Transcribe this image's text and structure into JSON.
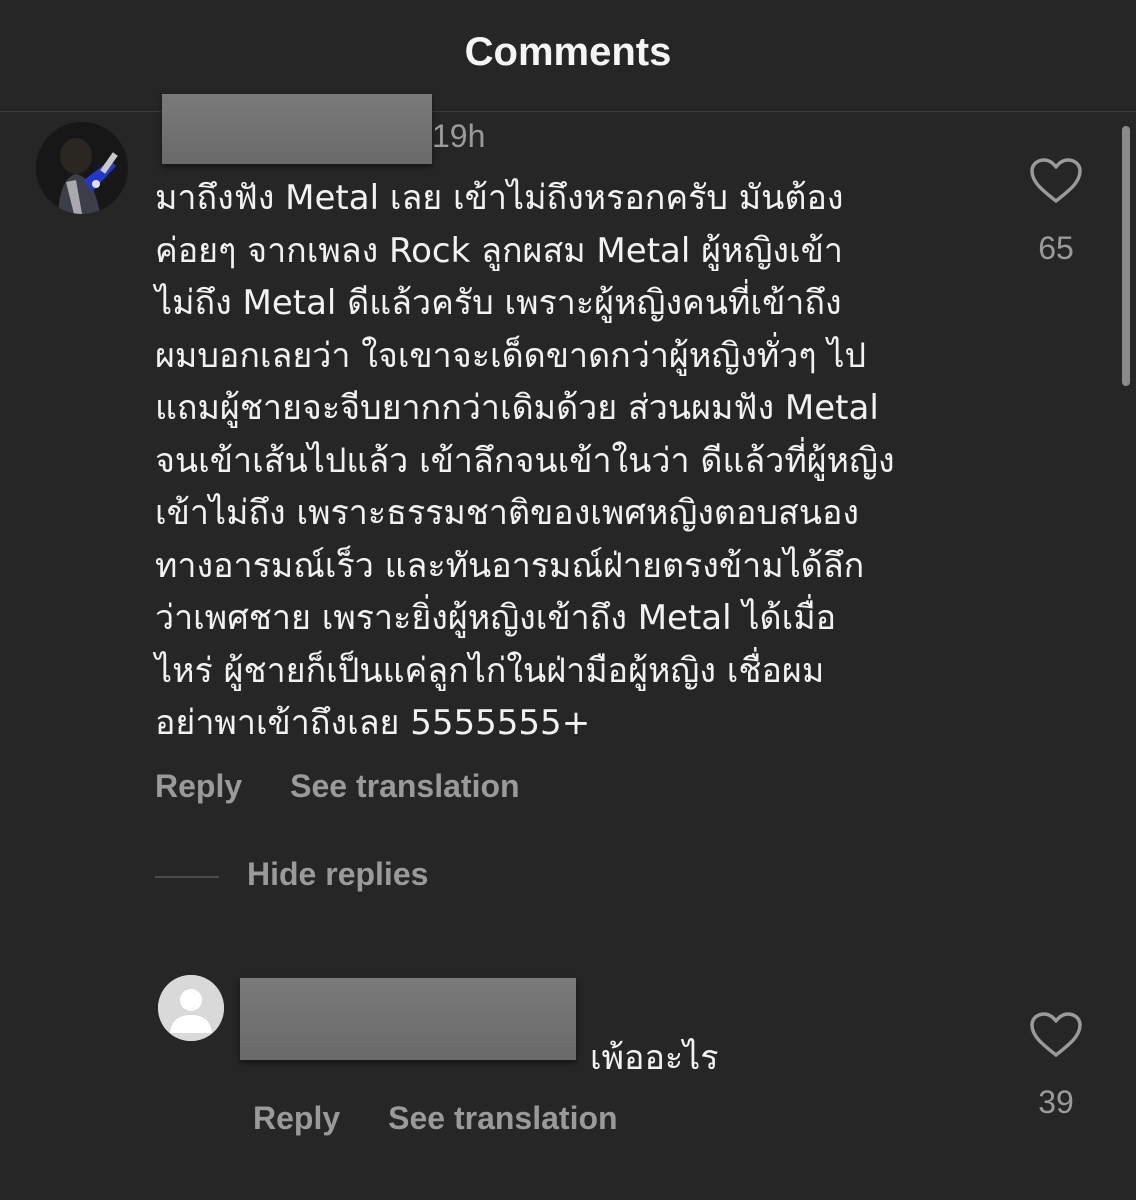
{
  "header": {
    "title": "Comments"
  },
  "comment": {
    "username": "",
    "time": "19h",
    "text": "มาถึงฟัง Metal เลย เข้าไม่ถึงหรอกครับ มันต้อง\nค่อยๆ จากเพลง Rock ลูกผสม Metal ผู้หญิงเข้า\nไม่ถึง Metal ดีแล้วครับ เพราะผู้หญิงคนที่เข้าถึง\nผมบอกเลยว่า ใจเขาจะเด็ดขาดกว่าผู้หญิงทั่วๆ ไป\nแถมผู้ชายจะจีบยากกว่าเดิมด้วย ส่วนผมฟัง Metal\nจนเข้าเส้นไปแล้ว เข้าลึกจนเข้าในว่า ดีแล้วที่ผู้หญิง\nเข้าไม่ถึง เพราะธรรมชาติของเพศหญิงตอบสนอง\nทางอารมณ์เร็ว และทันอารมณ์ฝ่ายตรงข้ามได้ลึก\nว่าเพศชาย เพราะยิ่งผู้หญิงเข้าถึง Metal ได้เมื่อ\nไหร่ ผู้ชายก็เป็นแค่ลูกไก่ในฝ่ามือผู้หญิง เชื่อผม\nอย่าพาเข้าถึงเลย 5555555+",
    "likes": "65",
    "reply_label": "Reply",
    "translate_label": "See translation",
    "like_icon": "heart-outline-icon"
  },
  "replies_toggle": {
    "label": "Hide replies"
  },
  "reply": {
    "text": "เพ้ออะไร",
    "likes": "39",
    "reply_label": "Reply",
    "translate_label": "See translation",
    "avatar_icon": "default-avatar-icon"
  },
  "colors": {
    "background": "#262626",
    "text_primary": "#f2f2f2",
    "text_secondary": "#9a9a9a",
    "redaction": "#737373"
  }
}
